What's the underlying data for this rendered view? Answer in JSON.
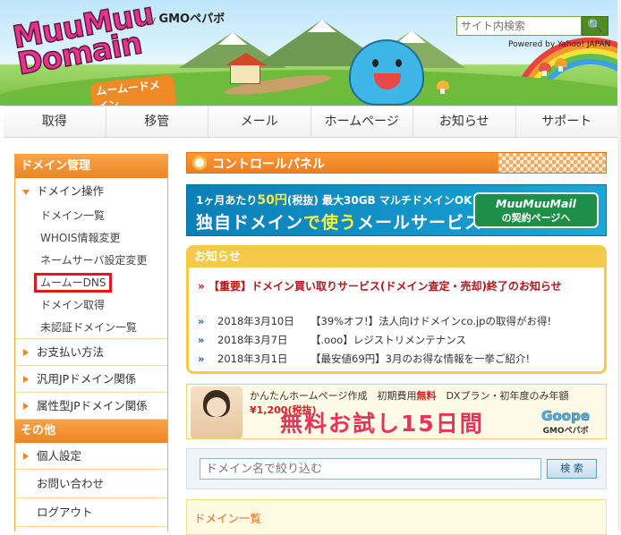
{
  "header": {
    "logo_text": "MuuMuu Domain",
    "logo_sub": "ムームードメイン",
    "byline_prefix": "by",
    "byline_brand": "GMOペパボ",
    "search_placeholder": "サイト内検索",
    "search_button": "🔍",
    "powered_by": "Powered by Yahoo! JAPAN"
  },
  "nav": {
    "items": [
      "取得",
      "移管",
      "メール",
      "ホームページ",
      "お知らせ",
      "サポート"
    ]
  },
  "sidebar": {
    "section1_title": "ドメイン管理",
    "domain_ops_label": "ドメイン操作",
    "domain_ops_items": [
      "ドメイン一覧",
      "WHOIS情報変更",
      "ネームサーバ設定変更",
      "ムームーDNS",
      "ドメイン取得",
      "未認証ドメイン一覧"
    ],
    "categories": [
      "お支払い方法",
      "汎用JPドメイン関係",
      "属性型JPドメイン関係"
    ],
    "section2_title": "その他",
    "personal_label": "個人設定",
    "contact_label": "お問い合わせ",
    "logout_label": "ログアウト"
  },
  "main": {
    "panel_title": "コントロールパネル",
    "mail_banner": {
      "top_pre": "1ヶ月あたり",
      "top_price": "50円",
      "top_post": "(税抜) 最大30GB マルチドメインOK!",
      "main_pre": "独自ドメイン",
      "main_mid": "で使う",
      "main_post": "メールサービス",
      "badge_title": "MuuMuuMail",
      "badge_sub": "の契約ページへ"
    },
    "news": {
      "title": "お知らせ",
      "headline_arrow": "»",
      "headline": "【重要】ドメイン買い取りサービス(ドメイン査定・売却)終了のお知らせ",
      "items": [
        {
          "date": "2018年3月10日",
          "text": "【39%オフ!】法人向けドメインco.jpの取得がお得!"
        },
        {
          "date": "2018年3月7日",
          "text": "【.ooo】レジストリメンテナンス"
        },
        {
          "date": "2018年3月1日",
          "text": "【最安値69円】3月のお得な情報を一挙ご紹介!"
        }
      ]
    },
    "hp_banner": {
      "top_a": "かんたんホームページ作成　初期費用",
      "top_free": "無料",
      "top_b": "　DXプラン・初年度のみ年額",
      "top_price": "¥1,200(税抜)",
      "main": "無料お試し15日間",
      "brand": "Goope",
      "brand_sub": "GMOペパボ"
    },
    "filter": {
      "placeholder": "ドメイン名で絞り込む",
      "button": "検 索"
    },
    "domain_list_title": "ドメイン一覧"
  },
  "colors": {
    "accent_orange": "#f08421",
    "highlight_red": "#e0191e",
    "news_yellow": "#f6c94a",
    "mail_blue": "#1ba7d8"
  }
}
